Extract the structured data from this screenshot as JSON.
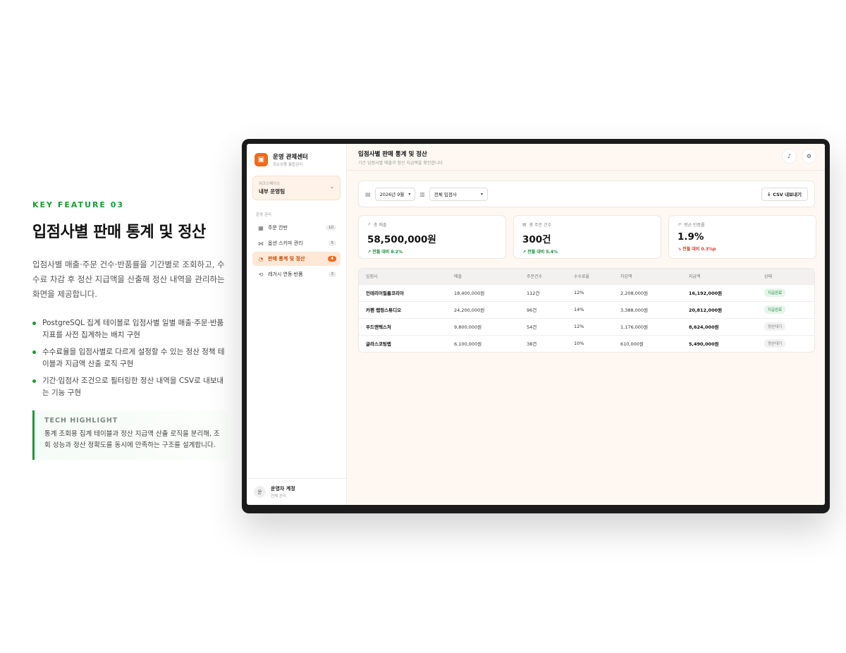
{
  "feature": {
    "eyebrow": "KEY FEATURE 03",
    "title": "입점사별 판매 통계 및 정산",
    "description": "입점사별 매출·주문 건수·반품률을 기간별로 조회하고, 수수료 차감 후 정산 지급액을 산출해 정산 내역을 관리하는 화면을 제공합니다.",
    "bullets": [
      "PostgreSQL 집계 테이블로 입점사별 일별 매출·주문·반품 지표를 사전 집계하는 배치 구현",
      "수수료율을 입점사별로 다르게 설정할 수 있는 정산 정책 테이블과 지급액 산출 로직 구현",
      "기간·입점사 조건으로 필터링한 정산 내역을 CSV로 내보내는 기능 구현"
    ],
    "highlight_title": "TECH HIGHLIGHT",
    "highlight_text": "통계 조회용 집계 테이블과 정산 지급액 산출 로직을 분리해, 조회 성능과 정산 정확도를 동시에 만족하는 구조를 설계합니다."
  },
  "app": {
    "brand_name": "운영 관제센터",
    "brand_sub": "희소상품 통합관리",
    "workspace_label": "워크스페이스",
    "workspace_name": "내부 운영팀",
    "section_label": "운영 관리",
    "nav": [
      {
        "label": "주문 칸반",
        "badge": "10",
        "icon": "kanban-icon"
      },
      {
        "label": "옵션 스키마 관리",
        "badge": "5",
        "icon": "schema-icon"
      },
      {
        "label": "판매 통계 및 정산",
        "badge": "4",
        "icon": "chart-icon",
        "active": true
      },
      {
        "label": "레거시 연동·반품",
        "badge": "3",
        "icon": "sync-icon"
      }
    ],
    "account_avatar": "운",
    "account_name": "운영자 계정",
    "account_role": "전체 관리",
    "page_title": "입점사별 판매 통계 및 정산",
    "page_subtitle": "기간·입점사별 매출과 정산 지급액을 확인합니다",
    "filters": {
      "period": "2026년 9월",
      "vendor": "전체 입점사",
      "export_label": "CSV 내보내기"
    },
    "kpis": [
      {
        "label": "총 매출",
        "value": "58,500,000원",
        "delta": "↗ 전월 대비 8.2%",
        "trend": "up",
        "icon": "trend-icon"
      },
      {
        "label": "총 주문 건수",
        "value": "300건",
        "delta": "↗ 전월 대비 5.4%",
        "trend": "up",
        "icon": "receipt-icon"
      },
      {
        "label": "평균 반품률",
        "value": "1.9%",
        "delta": "↘ 전월 대비 0.3%p",
        "trend": "down",
        "icon": "return-icon"
      }
    ],
    "table": {
      "headers": [
        "입점사",
        "매출",
        "주문건수",
        "수수료율",
        "차감액",
        "지급액",
        "상태"
      ],
      "rows": [
        [
          "인테리어필름코리아",
          "18,400,000원",
          "112건",
          "12%",
          "2,208,000원",
          "16,192,000원",
          "지급완료"
        ],
        [
          "카펜 랩핑스튜디오",
          "24,200,000원",
          "96건",
          "14%",
          "3,388,000원",
          "20,812,000원",
          "지급완료"
        ],
        [
          "우드앤텍스처",
          "9,800,000원",
          "54건",
          "12%",
          "1,176,000원",
          "8,624,000원",
          "정산대기"
        ],
        [
          "글라스코팅랩",
          "6,100,000원",
          "38건",
          "10%",
          "610,000원",
          "5,490,000원",
          "정산대기"
        ]
      ]
    }
  }
}
